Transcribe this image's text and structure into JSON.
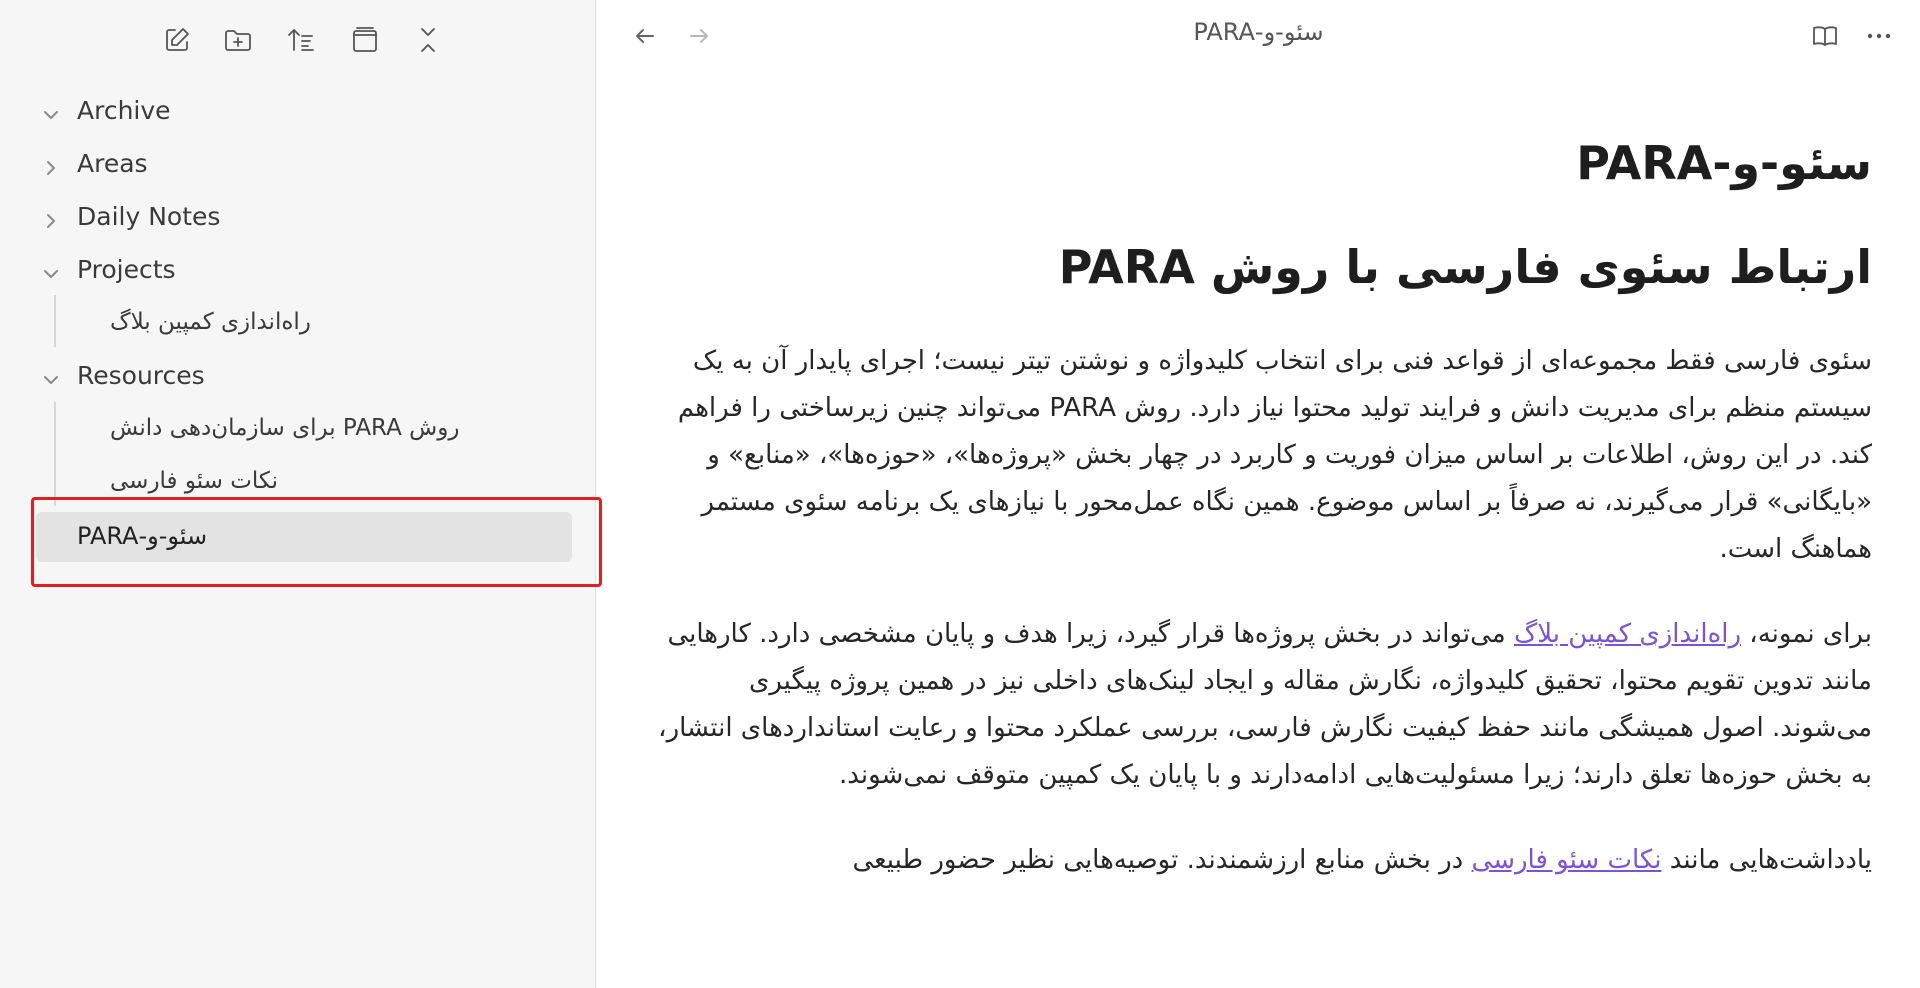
{
  "sidebar": {
    "toolbar": [
      {
        "icon": "new-note-icon"
      },
      {
        "icon": "new-folder-icon"
      },
      {
        "icon": "sort-icon"
      },
      {
        "icon": "collapse-view-icon"
      },
      {
        "icon": "collapse-all-icon"
      }
    ],
    "folders": {
      "archive": "Archive",
      "areas": "Areas",
      "daily_notes": "Daily Notes",
      "projects": "Projects",
      "resources": "Resources"
    },
    "files": {
      "project_campaign": "راه‌اندازی کمپین بلاگ",
      "resource_para": "روش PARA برای سازمان‌دهی دانش",
      "resource_seo": "نکات سئو فارسی",
      "active": "سئو-و-PARA"
    }
  },
  "header": {
    "title": "سئو-و-PARA",
    "back_icon": "arrow-left-icon",
    "forward_icon": "arrow-right-icon",
    "reading_icon": "book-open-icon",
    "more_icon": "more-options-icon"
  },
  "document": {
    "title": "سئو-و-PARA",
    "heading": "ارتباط سئوی فارسی با روش PARA",
    "p1": "سئوی فارسی فقط مجموعه‌ای از قواعد فنی برای انتخاب کلیدواژه و نوشتن تیتر نیست؛ اجرای پایدار آن به یک سیستم منظم برای مدیریت دانش و فرایند تولید محتوا نیاز دارد. روش PARA می‌تواند چنین زیرساختی را فراهم کند. در این روش، اطلاعات بر اساس میزان فوریت و کاربرد در چهار بخش «پروژه‌ها»، «حوزه‌ها»، «منابع» و «بایگانی» قرار می‌گیرند، نه صرفاً بر اساس موضوع. همین نگاه عمل‌محور با نیازهای یک برنامه سئوی مستمر هماهنگ است.",
    "p2_before": "برای نمونه، ",
    "p2_link": "راه‌اندازی کمپین بلاگ",
    "p2_after": " می‌تواند در بخش پروژه‌ها قرار گیرد، زیرا هدف و پایان مشخصی دارد. کارهایی مانند تدوین تقویم محتوا، تحقیق کلیدواژه، نگارش مقاله و ایجاد لینک‌های داخلی نیز در همین پروژه پیگیری می‌شوند. اصول همیشگی مانند حفظ کیفیت نگارش فارسی، بررسی عملکرد محتوا و رعایت استانداردهای انتشار، به بخش حوزه‌ها تعلق دارند؛ زیرا مسئولیت‌هایی ادامه‌دارند و با پایان یک کمپین متوقف نمی‌شوند.",
    "p3_before": "یادداشت‌هایی مانند ",
    "p3_link": "نکات سئو فارسی",
    "p3_after": " در بخش منابع ارزشمندند. توصیه‌هایی نظیر حضور طبیعی"
  }
}
